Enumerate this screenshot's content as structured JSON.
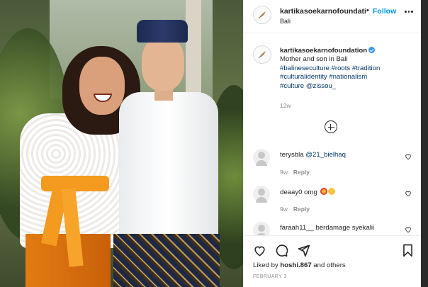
{
  "post": {
    "username": "kartikasoekarnofoundatic",
    "follow_label": "Follow",
    "dot": "•",
    "location": "Bali"
  },
  "caption": {
    "username": "kartikasoekarnofoundation",
    "text": "Mother and son in Bali",
    "hashtags_line1": "#balineseculture #roots #tradition",
    "hashtags_line2": "#culturalidentity #nationalism",
    "hashtags_line3_tag": "#culture",
    "mention": "@zissou_",
    "time_ago": "12w"
  },
  "comments": [
    {
      "username": "terysbla",
      "text": "@21_bielhaq",
      "age": "9w",
      "reply": "Reply"
    },
    {
      "username": "deaay0",
      "text": "omg",
      "age": "9w",
      "reply": "Reply",
      "emojis": [
        "heart-eyes-emoji",
        "crying-emoji"
      ]
    },
    {
      "username": "faraah11__",
      "text": "berdamage syekalii",
      "age": "",
      "reply": ""
    }
  ],
  "actions": {
    "liked_by_prefix": "Liked by",
    "liked_by_user": "hoshi.867",
    "liked_by_suffix": "and others",
    "date": "FEBRUARY 3"
  },
  "icons": {
    "avatar": "feather-logo-icon",
    "like": "heart-icon",
    "comment": "comment-bubble-icon",
    "share": "paper-plane-icon",
    "save": "bookmark-icon",
    "add": "plus-circle-icon",
    "more": "more-dots-icon"
  },
  "colors": {
    "link_blue": "#0095f6",
    "hashtag": "#00376b",
    "verified": "#3897f0",
    "muted": "#8e8e8e",
    "sash_orange": "#f39a1f"
  }
}
